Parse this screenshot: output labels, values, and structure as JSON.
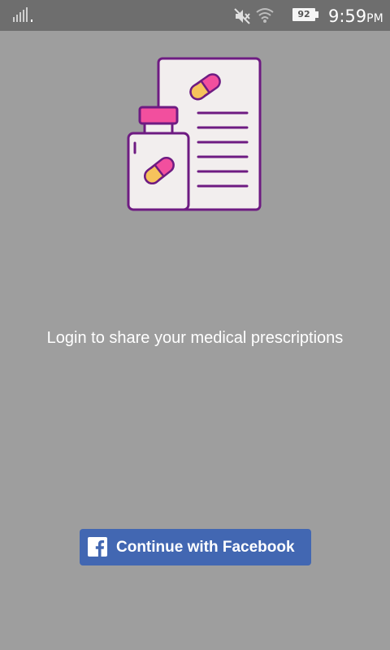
{
  "status_bar": {
    "battery_level": "92",
    "time": "9:59",
    "time_suffix": "PM",
    "icons": [
      "signal-icon",
      "mute-icon",
      "wifi-icon",
      "battery-icon"
    ]
  },
  "main": {
    "illustration": "prescription-pills-icon",
    "message": "Login to share your medical prescriptions"
  },
  "login": {
    "button_label": "Continue with Facebook",
    "button_icon": "facebook-icon",
    "button_color": "#4267b2"
  },
  "colors": {
    "background": "#9e9e9e",
    "status_bar": "#6e6e6e",
    "pill_pink": "#f24f9e",
    "pill_yellow": "#f6c35c",
    "outline_purple": "#6e1b82"
  }
}
